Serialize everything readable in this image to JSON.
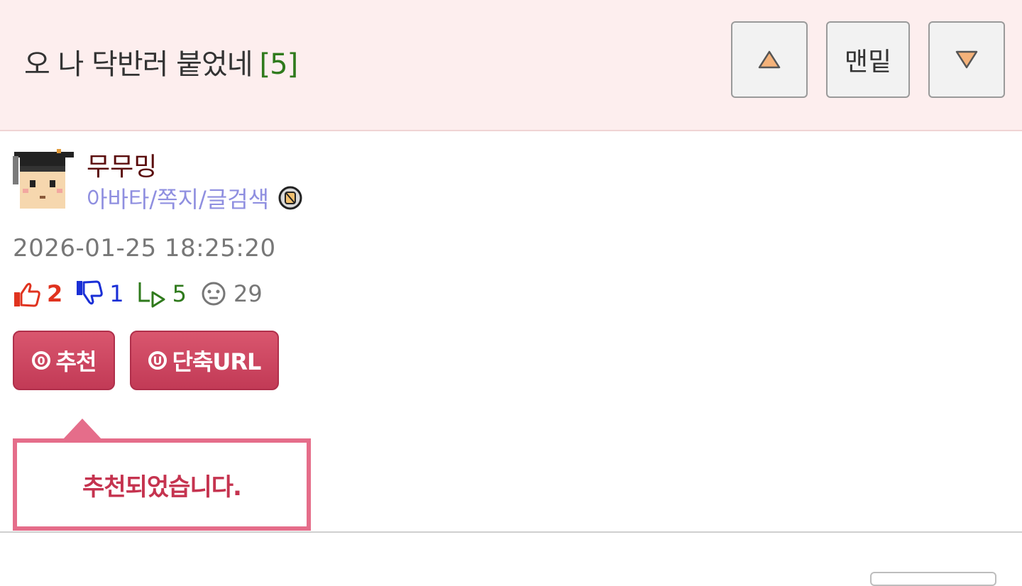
{
  "post": {
    "title": "오 나 닥반러 붙었네",
    "comment_count": "[5]"
  },
  "nav": {
    "up_icon": "triangle-up-icon",
    "bottom_label": "맨밑",
    "down_icon": "triangle-down-icon"
  },
  "author": {
    "name": "무무밍",
    "links": "아바타/쪽지/글검색",
    "avatar_icon": "graduation-cap-avatar"
  },
  "meta": {
    "date": "2026-01-25 18:25:20",
    "upvotes": "2",
    "downvotes": "1",
    "replies": "5",
    "views": "29"
  },
  "actions": {
    "recommend_label": "추천",
    "recommend_glyph": "0",
    "shorturl_label": "단축URL",
    "shorturl_glyph": "U"
  },
  "tooltip": {
    "message": "추천되었습니다."
  },
  "colors": {
    "header_bg": "#fdeeee",
    "accent": "#c23a56",
    "author_name": "#5a0b0b",
    "link": "#8f8fe0",
    "comment_count": "#2f7a1c"
  }
}
